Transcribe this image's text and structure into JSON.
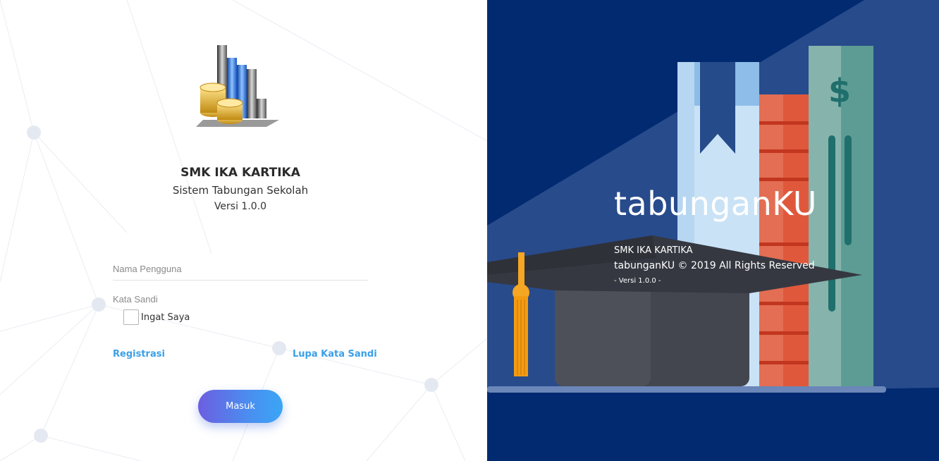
{
  "login": {
    "school_name": "SMK IKA KARTIKA",
    "app_subtitle": "Sistem Tabungan Sekolah",
    "version": "Versi 1.0.0",
    "username_placeholder": "Nama Pengguna",
    "password_placeholder": "Kata Sandi",
    "remember_label": "Ingat Saya",
    "remember_checked": false,
    "register_link": "Registrasi",
    "forgot_link": "Lupa Kata Sandi",
    "submit_label": "Masuk"
  },
  "brand_panel": {
    "app_name": "tabunganKU",
    "school_name": "SMK IKA KARTIKA",
    "copyright": "tabunganKU © 2019 All Rights Reserved",
    "version": "- Versi 1.0.0 -"
  },
  "icons": {
    "logo": "chart-coins-logo",
    "hero": "books-graduation-cap-illustration"
  },
  "colors": {
    "accent": "#3aa0e8",
    "button_start": "#6c5ee0",
    "button_end": "#3aa6f5",
    "panel_bg": "#022a70"
  }
}
